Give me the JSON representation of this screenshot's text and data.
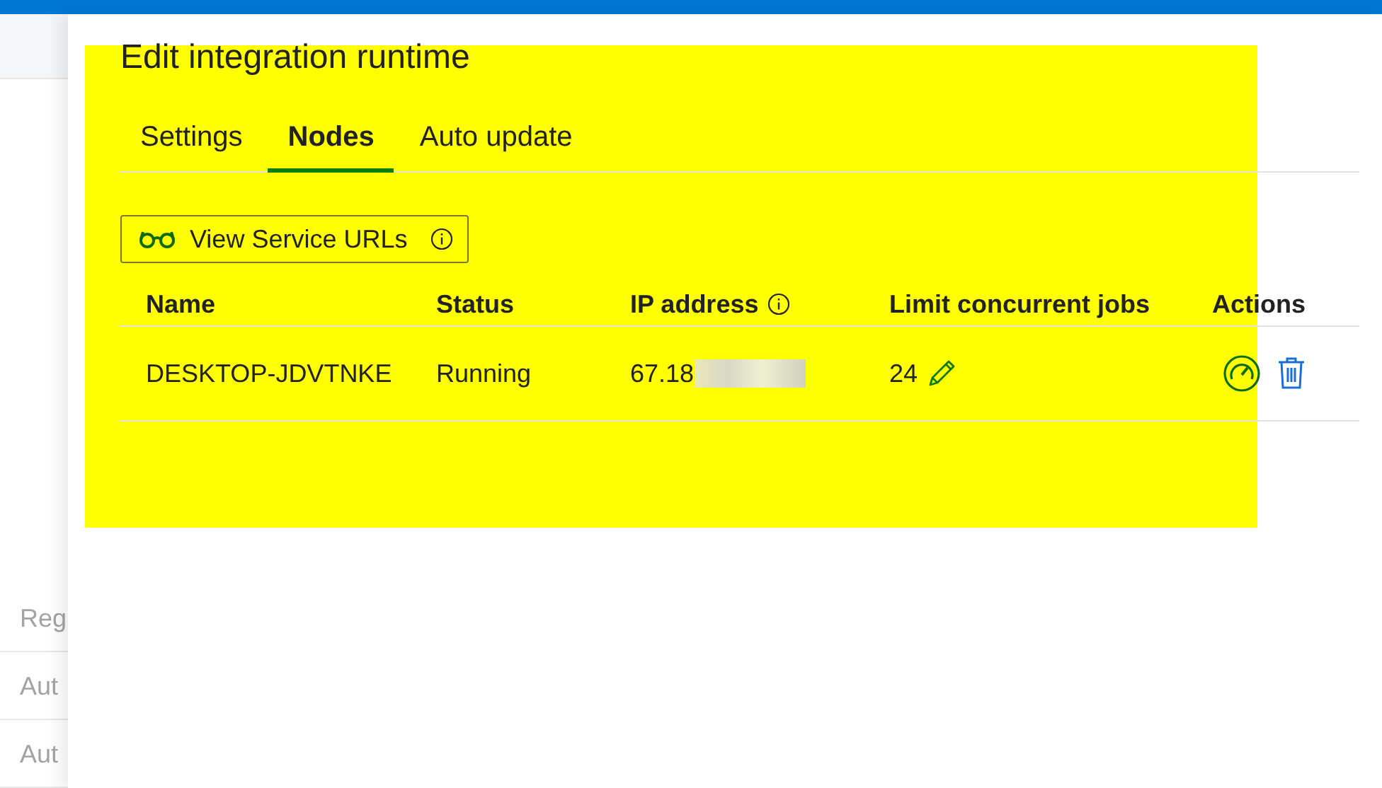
{
  "background_list": {
    "header": "Reg",
    "rows": [
      "Aut",
      "Aut"
    ]
  },
  "panel": {
    "title": "Edit integration runtime",
    "tabs": [
      {
        "label": "Settings",
        "selected": false
      },
      {
        "label": "Nodes",
        "selected": true
      },
      {
        "label": "Auto update",
        "selected": false
      }
    ],
    "service_button": {
      "label": "View Service URLs"
    },
    "table": {
      "columns": [
        {
          "label": "Name",
          "info": false
        },
        {
          "label": "Status",
          "info": false
        },
        {
          "label": "IP address",
          "info": true
        },
        {
          "label": "Limit concurrent jobs",
          "info": false
        },
        {
          "label": "Actions",
          "info": false
        }
      ],
      "rows": [
        {
          "name": "DESKTOP-JDVTNKE",
          "status": "Running",
          "ip_address": "67.18",
          "ip_redacted": true,
          "limit_concurrent_jobs": "24"
        }
      ]
    }
  },
  "highlight": {
    "color": "#ffff00"
  }
}
